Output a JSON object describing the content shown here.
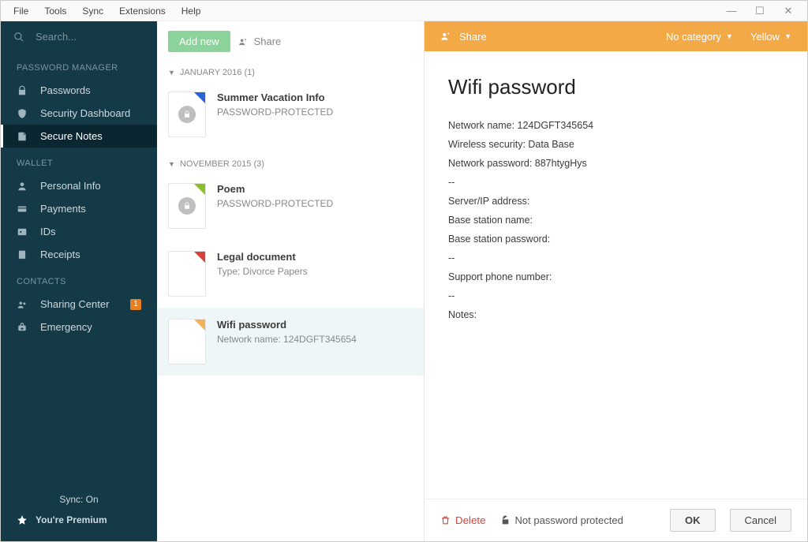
{
  "menubar": {
    "items": [
      "File",
      "Tools",
      "Sync",
      "Extensions",
      "Help"
    ]
  },
  "sidebar": {
    "search_placeholder": "Search...",
    "sections": {
      "pm": {
        "header": "PASSWORD MANAGER",
        "items": [
          "Passwords",
          "Security Dashboard",
          "Secure Notes"
        ]
      },
      "wallet": {
        "header": "WALLET",
        "items": [
          "Personal Info",
          "Payments",
          "IDs",
          "Receipts"
        ]
      },
      "contacts": {
        "header": "CONTACTS",
        "items": [
          "Sharing Center",
          "Emergency"
        ],
        "sharing_badge": "1"
      }
    },
    "sync_label": "Sync: On",
    "premium_label": "You're Premium"
  },
  "list": {
    "add_label": "Add new",
    "share_label": "Share",
    "groups": [
      {
        "header": "JANUARY 2016 (1)",
        "items": [
          {
            "title": "Summer Vacation Info",
            "sub": "PASSWORD-PROTECTED",
            "color": "blue",
            "locked": true
          }
        ]
      },
      {
        "header": "NOVEMBER 2015 (3)",
        "items": [
          {
            "title": "Poem",
            "sub": "PASSWORD-PROTECTED",
            "color": "green",
            "locked": true
          },
          {
            "title": "Legal document",
            "sub": "Type:  Divorce Papers",
            "color": "red",
            "locked": false
          },
          {
            "title": "Wifi password",
            "sub": "Network name:  124DGFT345654",
            "color": "orange",
            "locked": false,
            "selected": true
          }
        ]
      }
    ]
  },
  "detail": {
    "share_label": "Share",
    "category_label": "No category",
    "color_label": "Yellow",
    "title": "Wifi password",
    "fields": [
      "Network name:  124DGFT345654",
      "Wireless security:  Data Base",
      "Network password:  887htygHys",
      "--",
      "Server/IP address:",
      "Base station name:",
      "Base station password:",
      "--",
      "Support phone number:",
      "--",
      "Notes:"
    ],
    "delete_label": "Delete",
    "protected_label": "Not password protected",
    "ok_label": "OK",
    "cancel_label": "Cancel"
  }
}
